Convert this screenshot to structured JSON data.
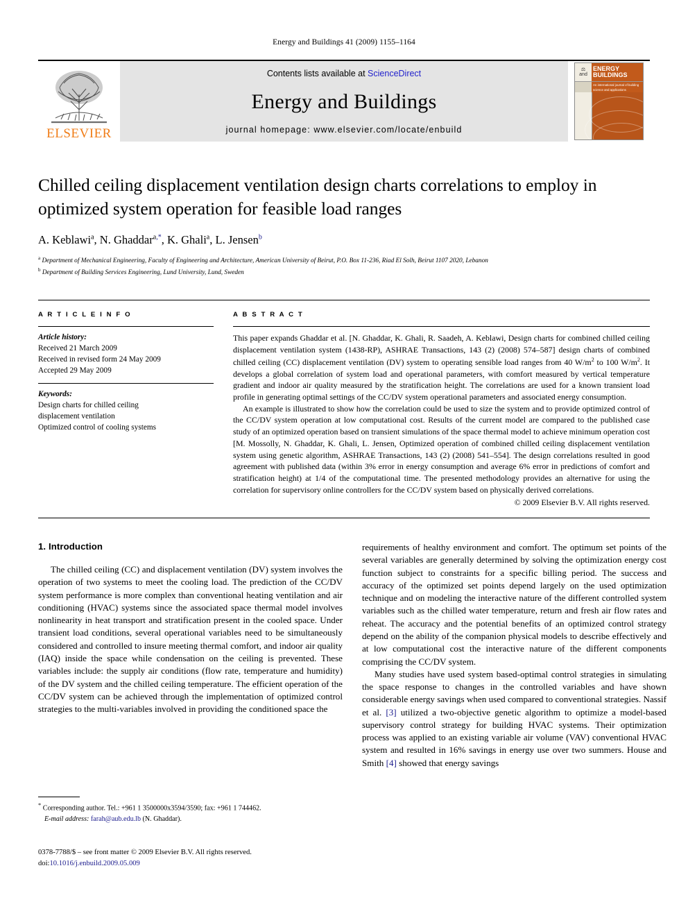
{
  "running_head": "Energy and Buildings 41 (2009) 1155–1164",
  "masthead": {
    "contents_prefix": "Contents lists available at",
    "sciencedirect": "ScienceDirect",
    "journal_title": "Energy and Buildings",
    "homepage": "journal homepage: www.elsevier.com/locate/enbuild",
    "publisher_wordmark": "ELSEVIER",
    "cover": {
      "line1": "ENERGY",
      "line2": "BUILDINGS",
      "and": "and",
      "tagline": "An international journal of building science and applications"
    }
  },
  "title": "Chilled ceiling displacement ventilation design charts correlations to employ in optimized system operation for feasible load ranges",
  "authors": [
    {
      "name": "A. Keblawi",
      "sup": "a",
      "mark": ""
    },
    {
      "name": "N. Ghaddar",
      "sup": "a",
      "mark": ",*"
    },
    {
      "name": "K. Ghali",
      "sup": "a",
      "mark": ""
    },
    {
      "name": "L. Jensen",
      "sup": "b",
      "mark": ""
    }
  ],
  "affiliations": [
    {
      "sup": "a",
      "text": "Department of Mechanical Engineering, Faculty of Engineering and Architecture, American University of Beirut, P.O. Box 11-236, Riad El Solh, Beirut 1107 2020, Lebanon"
    },
    {
      "sup": "b",
      "text": "Department of Building Services Engineering, Lund University, Lund, Sweden"
    }
  ],
  "article_info": {
    "heading": "A R T I C L E  I N F O",
    "history_label": "Article history:",
    "history": [
      "Received 21 March 2009",
      "Received in revised form 24 May 2009",
      "Accepted 29 May 2009"
    ],
    "keywords_label": "Keywords:",
    "keywords": [
      "Design charts for chilled ceiling",
      "displacement ventilation",
      "Optimized control of cooling systems"
    ]
  },
  "abstract": {
    "heading": "A B S T R A C T",
    "paragraph1_a": "This paper expands Ghaddar et al. [N. Ghaddar, K. Ghali, R. Saadeh, A. Keblawi, Design charts for combined chilled ceiling displacement ventilation system (1438-RP), ASHRAE Transactions, 143 (2) (2008) 574–587] design charts of combined chilled ceiling (CC) displacement ventilation (DV) system to operating sensible load ranges from 40 W/m",
    "paragraph1_sup1": "2",
    "paragraph1_b": " to 100 W/m",
    "paragraph1_sup2": "2",
    "paragraph1_c": ". It develops a global correlation of system load and operational parameters, with comfort measured by vertical temperature gradient and indoor air quality measured by the stratification height. The correlations are used for a known transient load profile in generating optimal settings of the CC/DV system operational parameters and associated energy consumption.",
    "paragraph2": "An example is illustrated to show how the correlation could be used to size the system and to provide optimized control of the CC/DV system operation at low computational cost. Results of the current model are compared to the published case study of an optimized operation based on transient simulations of the space thermal model to achieve minimum operation cost [M. Mossolly, N. Ghaddar, K. Ghali, L. Jensen, Optimized operation of combined chilled ceiling displacement ventilation system using genetic algorithm, ASHRAE Transactions, 143 (2) (2008) 541–554]. The design correlations resulted in good agreement with published data (within 3% error in energy consumption and average 6% error in predictions of comfort and stratification height) at 1/4 of the computational time. The presented methodology provides an alternative for using the correlation for supervisory online controllers for the CC/DV system based on physically derived correlations.",
    "copyright": "© 2009 Elsevier B.V. All rights reserved."
  },
  "body": {
    "section_number_title": "1. Introduction",
    "left_paragraph_1": "The chilled ceiling (CC) and displacement ventilation (DV) system involves the operation of two systems to meet the cooling load. The prediction of the CC/DV system performance is more complex than conventional heating ventilation and air conditioning (HVAC) systems since the associated space thermal model involves nonlinearity in heat transport and stratification present in the cooled space. Under transient load conditions, several operational variables need to be simultaneously considered and controlled to insure meeting thermal comfort, and indoor air quality (IAQ) inside the space while condensation on the ceiling is prevented. These variables include: the supply air conditions (flow rate, temperature and humidity) of the DV system and the chilled ceiling temperature. The efficient operation of the CC/DV system can be achieved through the implementation of optimized control strategies to the multi-variables involved in providing the conditioned space the",
    "right_paragraph_1": "requirements of healthy environment and comfort. The optimum set points of the several variables are generally determined by solving the optimization energy cost function subject to constraints for a specific billing period. The success and accuracy of the optimized set points depend largely on the used optimization technique and on modeling the interactive nature of the different controlled system variables such as the chilled water temperature, return and fresh air flow rates and reheat. The accuracy and the potential benefits of an optimized control strategy depend on the ability of the companion physical models to describe effectively and at low computational cost the interactive nature of the different components comprising the CC/DV system.",
    "right_paragraph_2_a": "Many studies have used system based-optimal control strategies in simulating the space response to changes in the controlled variables and have shown considerable energy savings when used compared to conventional strategies. Nassif et al. ",
    "right_paragraph_2_ref1": "[3]",
    "right_paragraph_2_b": " utilized a two-objective genetic algorithm to optimize a model-based supervisory control strategy for building HVAC systems. Their optimization process was applied to an existing variable air volume (VAV) conventional HVAC system and resulted in 16% savings in energy use over two summers. House and Smith ",
    "right_paragraph_2_ref2": "[4]",
    "right_paragraph_2_c": " showed that energy savings"
  },
  "footnote": {
    "star": "*",
    "corresponding": "Corresponding author. Tel.: +961 1 3500000x3594/3590; fax: +961 1 744462.",
    "email_label": "E-mail address:",
    "email": "farah@aub.edu.lb",
    "email_owner": "(N. Ghaddar)."
  },
  "imprint": {
    "line1": "0378-7788/$ – see front matter © 2009 Elsevier B.V. All rights reserved.",
    "doi_label": "doi:",
    "doi_value": "10.1016/j.enbuild.2009.05.009"
  }
}
